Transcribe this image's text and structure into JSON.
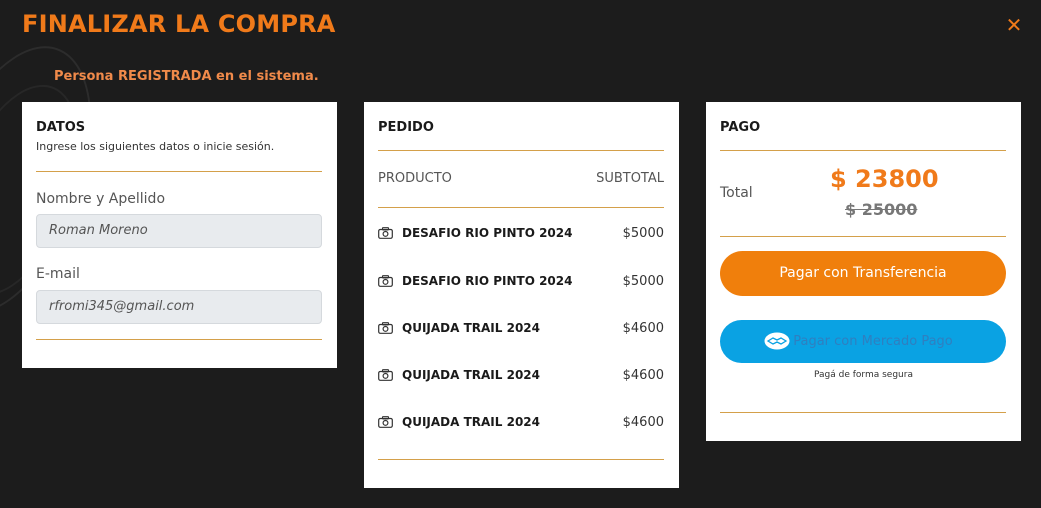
{
  "title": "FINALIZAR LA COMPRA",
  "close_symbol": "✕",
  "notice": "Persona REGISTRADA en el sistema.",
  "datos": {
    "title": "DATOS",
    "subtitle": "Ingrese los siguientes datos o inicie sesión.",
    "name_label": "Nombre y Apellido",
    "name_value": "Roman Moreno",
    "email_label": "E-mail",
    "email_value": "rfromi345@gmail.com"
  },
  "pedido": {
    "title": "PEDIDO",
    "col_product": "PRODUCTO",
    "col_subtotal": "SUBTOTAL",
    "items": [
      {
        "name": "DESAFIO RIO PINTO 2024",
        "price": "$5000",
        "icon": "camera-icon"
      },
      {
        "name": "DESAFIO RIO PINTO 2024",
        "price": "$5000",
        "icon": "camera-icon"
      },
      {
        "name": "QUIJADA TRAIL 2024",
        "price": "$4600",
        "icon": "camera-icon"
      },
      {
        "name": "QUIJADA TRAIL 2024",
        "price": "$4600",
        "icon": "camera-icon"
      },
      {
        "name": "QUIJADA TRAIL 2024",
        "price": "$4600",
        "icon": "camera-icon"
      }
    ]
  },
  "pago": {
    "title": "PAGO",
    "total_label": "Total",
    "total_price": "$ 23800",
    "old_price": "$ 25000",
    "transfer_button": "Pagar con Transferencia",
    "mp_button": "Pagar con Mercado Pago",
    "mp_icon": "handshake-icon",
    "secure_text": "Pagá de forma segura"
  },
  "colors": {
    "accent": "#f07a1a",
    "background": "#1c1c1c",
    "divider": "#d4a04a",
    "transfer_button": "#f07f0c",
    "mp_button": "#0aa2e3"
  }
}
